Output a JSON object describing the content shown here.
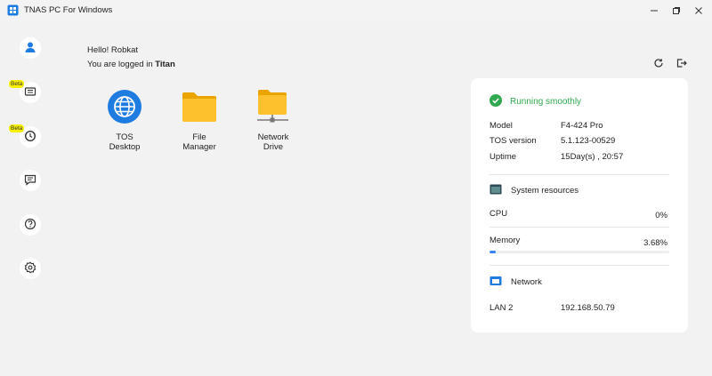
{
  "window": {
    "title": "TNAS PC For Windows",
    "controls": [
      "minimize-icon",
      "maximize-icon",
      "close-icon"
    ]
  },
  "sidebar": {
    "items": [
      {
        "name": "user",
        "icon": "user-icon"
      },
      {
        "name": "storage",
        "icon": "storage-icon",
        "badge": "Beta"
      },
      {
        "name": "backup",
        "icon": "backup-clock-icon",
        "badge": "Beta"
      },
      {
        "name": "messages",
        "icon": "message-icon"
      },
      {
        "name": "help",
        "icon": "help-icon"
      },
      {
        "name": "settings",
        "icon": "gear-icon"
      }
    ]
  },
  "header": {
    "greeting": "Hello! Robkat",
    "login_prefix": "You are logged in",
    "device_name": "Titan",
    "actions": [
      "refresh-icon",
      "logout-icon"
    ]
  },
  "apps": [
    {
      "label": "TOS\nDesktop",
      "icon": "globe-icon"
    },
    {
      "label": "File\nManager",
      "icon": "folder-icon"
    },
    {
      "label": "Network\nDrive",
      "icon": "network-folder-icon"
    }
  ],
  "status": {
    "state": "Running smoothly",
    "state_color": "#2fa84f",
    "model_label": "Model",
    "model_value": "F4-424 Pro",
    "version_label": "TOS version",
    "version_value": "5.1.123-00529",
    "uptime_label": "Uptime",
    "uptime_value": "15Day(s) , 20:57",
    "resources_title": "System resources",
    "cpu_label": "CPU",
    "cpu_value": "0%",
    "memory_label": "Memory",
    "memory_value": "3.68%",
    "memory_fraction": 0.0368,
    "network_title": "Network",
    "lan_label": "LAN 2",
    "lan_value": "192.168.50.79",
    "accent": "#3b82f6"
  }
}
